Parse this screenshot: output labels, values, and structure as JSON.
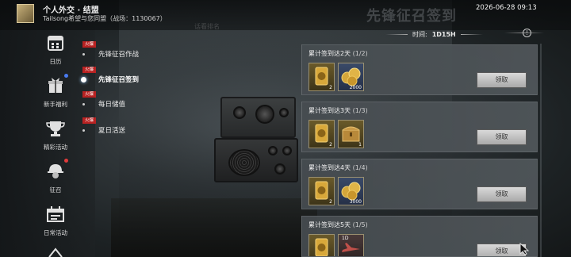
{
  "header": {
    "title": "个人外交 · 结盟",
    "subtitle": "Tailsong希望与您同盟（战场：1130067）",
    "datetime": "2026-06-28 09:13",
    "page_title": "先锋征召签到",
    "ghost_text": "话看排名"
  },
  "timer": {
    "label": "时间:",
    "value": "1D15H"
  },
  "sidebar": {
    "items": [
      {
        "label": "日历",
        "icon": "calendar-icon"
      },
      {
        "label": "新手福利",
        "icon": "gift-box-icon"
      },
      {
        "label": "精彩活动",
        "icon": "trophy-icon"
      },
      {
        "label": "征召",
        "icon": "soldier-helmet-icon"
      },
      {
        "label": "日常活动",
        "icon": "daily-calendar-icon"
      }
    ]
  },
  "submenu": {
    "items": [
      {
        "tag": "火爆",
        "label": "先锋征召作战"
      },
      {
        "tag": "火爆",
        "label": "先锋征召签到"
      },
      {
        "tag": "火爆",
        "label": "每日储值"
      },
      {
        "tag": "火爆",
        "label": "夏日活送"
      }
    ]
  },
  "cards": [
    {
      "title": "累计签到达2天",
      "progress": "(1/2)",
      "items": [
        {
          "icon": "gold-badge-icon",
          "count": "2"
        },
        {
          "icon": "coins-icon",
          "count": "2000"
        }
      ],
      "button": "领取"
    },
    {
      "title": "累计签到达3天",
      "progress": "(1/3)",
      "items": [
        {
          "icon": "gold-badge-icon",
          "count": "2"
        },
        {
          "icon": "chest-icon",
          "count": "1"
        }
      ],
      "button": "领取"
    },
    {
      "title": "累计签到达4天",
      "progress": "(1/4)",
      "items": [
        {
          "icon": "gold-badge-icon",
          "count": "2"
        },
        {
          "icon": "coins-icon",
          "count": "3000"
        }
      ],
      "button": "领取"
    },
    {
      "title": "累计签到达5天",
      "progress": "(1/5)",
      "items": [
        {
          "icon": "gold-badge-icon",
          "count": ""
        },
        {
          "icon": "plane-icon",
          "count": "1D"
        }
      ],
      "button": "领取"
    }
  ],
  "colors": {
    "tag_red": "#b82222",
    "badge_red": "#e23b3b",
    "badge_blue": "#4a7bf0"
  }
}
